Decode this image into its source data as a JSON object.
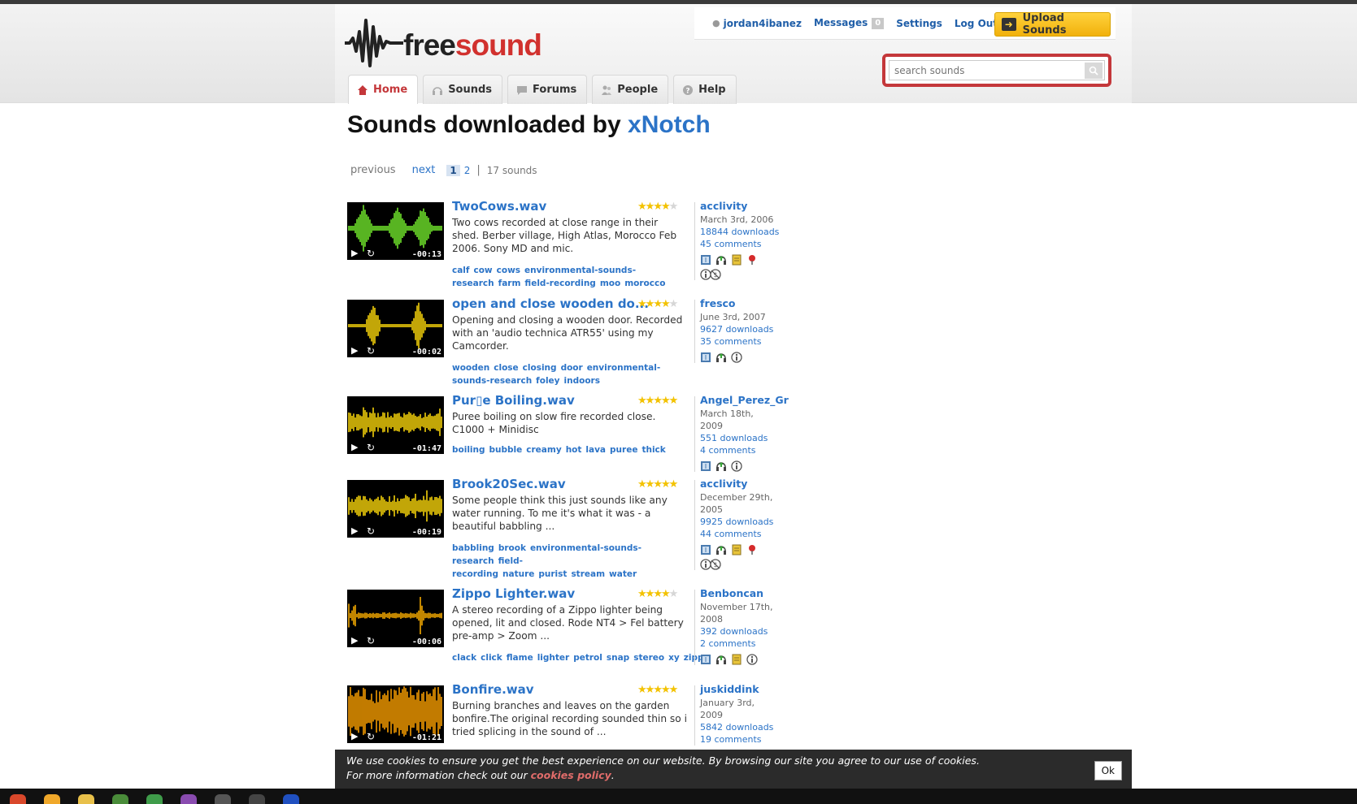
{
  "header": {
    "logo": {
      "part1": "free",
      "part2": "sound"
    },
    "user": {
      "username": "jordan4ibanez",
      "messages_label": "Messages",
      "messages_count": "0",
      "settings_label": "Settings",
      "logout_label": "Log Out"
    },
    "upload_label": "Upload Sounds",
    "search": {
      "placeholder": "search sounds"
    },
    "tabs": [
      {
        "label": "Home",
        "active": true
      },
      {
        "label": "Sounds",
        "active": false
      },
      {
        "label": "Forums",
        "active": false
      },
      {
        "label": "People",
        "active": false
      },
      {
        "label": "Help",
        "active": false
      }
    ]
  },
  "main": {
    "title_prefix": "Sounds downloaded by",
    "title_user": "xNotch",
    "pager": {
      "previous": "previous",
      "next": "next",
      "current": "1",
      "other": "2",
      "separator": "|",
      "count": "17 sounds"
    }
  },
  "sounds": [
    {
      "title": "TwoCows.wav",
      "rating": 4,
      "duration": "-00:13",
      "wave_color": "#6ee22a",
      "description": "Two cows recorded at close range in their shed. Berber village, High Atlas, Morocco Feb 2006. Sony MD and mic.",
      "tags": [
        "calf",
        "cow",
        "cows",
        "environmental-sounds-research",
        "farm",
        "field-recording",
        "moo",
        "morocco"
      ],
      "user": "acclivity",
      "date": "March 3rd, 2006",
      "downloads": "18844 downloads",
      "comments": "45 comments"
    },
    {
      "title": "open and close wooden do...",
      "rating": 4,
      "duration": "-00:02",
      "wave_color": "#f2d00a",
      "description": "Opening and closing a wooden door. Recorded with an 'audio technica ATR55' using my Camcorder.",
      "tags": [
        "wooden",
        "close",
        "closing",
        "door",
        "environmental-sounds-research",
        "foley",
        "indoors"
      ],
      "user": "fresco",
      "date": "June 3rd, 2007",
      "downloads": "9627 downloads",
      "comments": "35 comments"
    },
    {
      "title": "Pur▯e Boiling.wav",
      "rating": 4.5,
      "duration": "-01:47",
      "wave_color": "#f2d00a",
      "description": "Puree boiling on slow fire recorded close. C1000 + Minidisc",
      "tags": [
        "boiling",
        "bubble",
        "creamy",
        "hot",
        "lava",
        "puree",
        "thick"
      ],
      "user": "Angel_Perez_Gr",
      "date": "March 18th, 2009",
      "downloads": "551 downloads",
      "comments": "4 comments"
    },
    {
      "title": "Brook20Sec.wav",
      "rating": 4.5,
      "duration": "-00:19",
      "wave_color": "#f2d00a",
      "description": "Some people think this just sounds like any water running. To me it's what it was - a beautiful babbling ...",
      "tags": [
        "babbling",
        "brook",
        "environmental-sounds-research",
        "field-recording",
        "nature",
        "purist",
        "stream",
        "water"
      ],
      "user": "acclivity",
      "date": "December 29th, 2005",
      "downloads": "9925 downloads",
      "comments": "44 comments"
    },
    {
      "title": "Zippo Lighter.wav",
      "rating": 4,
      "duration": "-00:06",
      "wave_color": "#f2a800",
      "description": "A stereo recording of a Zippo lighter being opened, lit and closed. Rode NT4 > Fel battery pre-amp > Zoom ...",
      "tags": [
        "clack",
        "click",
        "flame",
        "lighter",
        "petrol",
        "snap",
        "stereo",
        "xy",
        "zippo"
      ],
      "user": "Benboncan",
      "date": "November 17th, 2008",
      "downloads": "392 downloads",
      "comments": "2 comments"
    },
    {
      "title": "Bonfire.wav",
      "rating": 4.5,
      "duration": "-01:21",
      "wave_color": "#f29a00",
      "description": "Burning branches and leaves on the garden bonfire.The original recording sounded thin so i tried splicing in the sound of ...",
      "tags": [],
      "user": "juskiddink",
      "date": "January 3rd, 2009",
      "downloads": "5842 downloads",
      "comments": "19 comments"
    }
  ],
  "cookie": {
    "text1": "We use cookies to ensure you get the best experience on our website. By browsing our site you agree to our use of cookies.",
    "text2": "For more information check out our",
    "link": "cookies policy",
    "text3": ".",
    "ok_label": "Ok"
  },
  "colors": {
    "brand_red": "#d1312e",
    "link_blue": "#2b73c7",
    "star": "#f3c200"
  }
}
